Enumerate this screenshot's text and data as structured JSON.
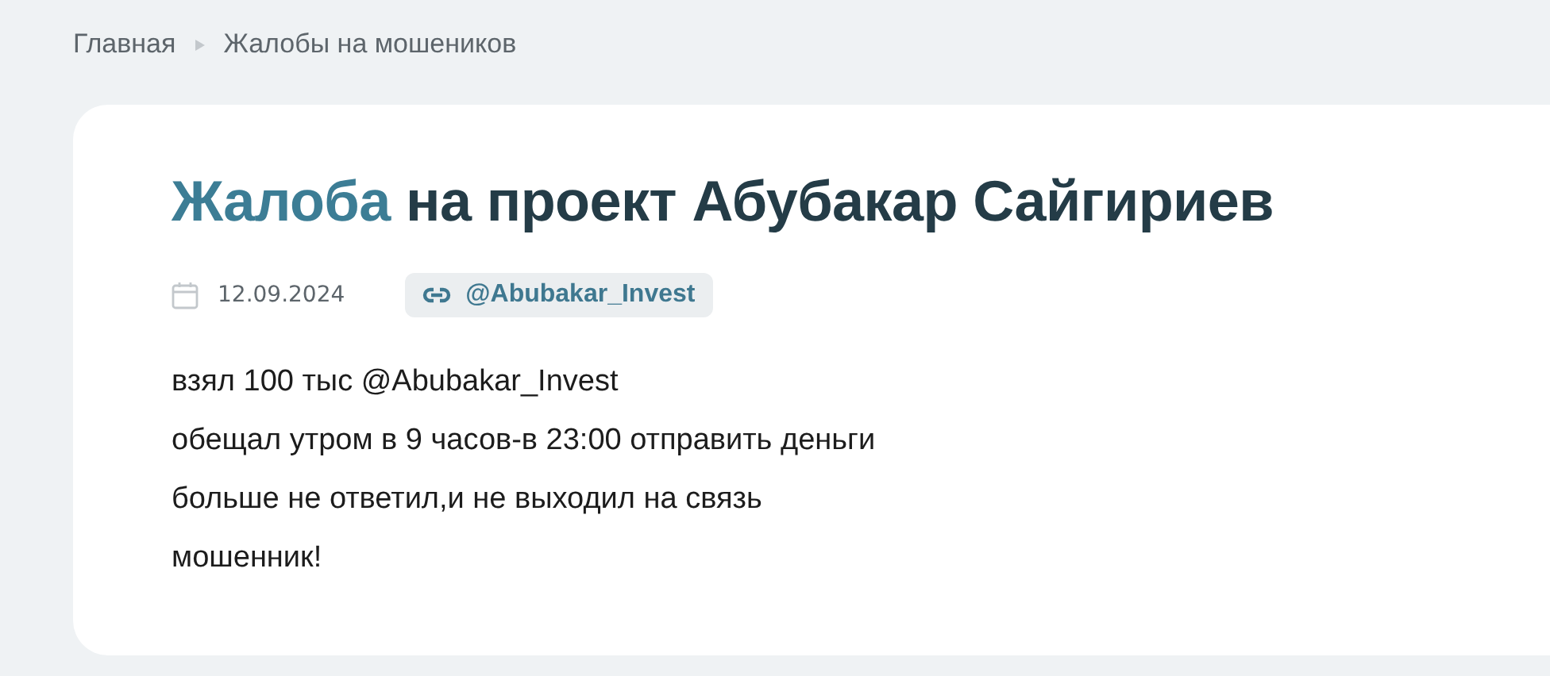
{
  "breadcrumbs": [
    {
      "label": "Главная"
    },
    {
      "label": "Жалобы на мошеников"
    }
  ],
  "complaint": {
    "title_highlight": "Жалоба",
    "title_rest": "на проект Абубакар Сайгириев",
    "date": "12.09.2024",
    "tag": "@Abubakar_Invest",
    "lines": [
      "взял 100 тыс @Abubakar_Invest",
      "обещал утром в 9 часов-в 23:00 отправить деньги",
      "больше не ответил,и не выходил на связь",
      "мошенник!"
    ]
  }
}
